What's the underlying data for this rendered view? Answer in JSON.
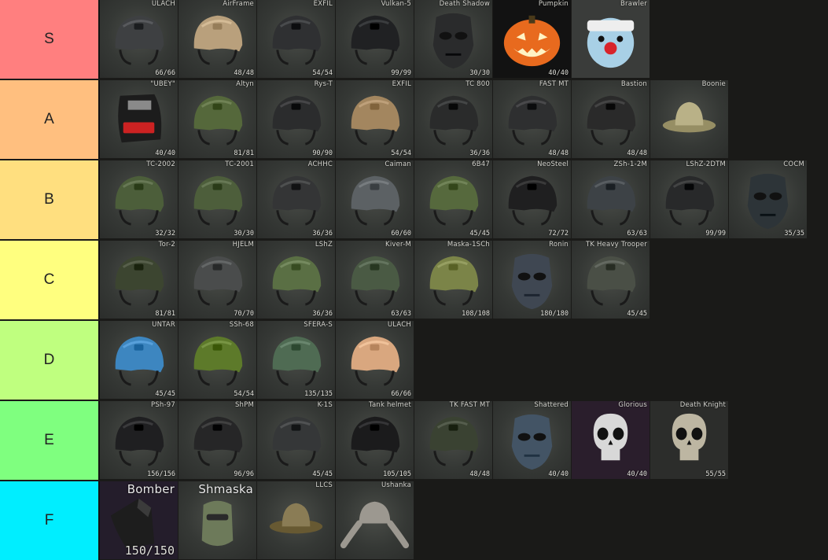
{
  "tiers": [
    {
      "label": "S",
      "color": "#ff7f7f",
      "items": [
        {
          "name": "ULACH",
          "durability": "66/66",
          "helmet": "#3e4042",
          "kind": "helmet"
        },
        {
          "name": "AirFrame",
          "durability": "48/48",
          "helmet": "#b9a07c",
          "kind": "helmet"
        },
        {
          "name": "EXFIL",
          "durability": "54/54",
          "helmet": "#2f3032",
          "kind": "helmet"
        },
        {
          "name": "Vulkan-5",
          "durability": "99/99",
          "helmet": "#202123",
          "kind": "helmet"
        },
        {
          "name": "Death Shadow",
          "durability": "30/30",
          "helmet": "#2a2b2c",
          "kind": "mask"
        },
        {
          "name": "Pumpkin",
          "durability": "40/40",
          "helmet": "#e86a1e",
          "kind": "pumpkin",
          "bg": "#121212"
        },
        {
          "name": "Brawler",
          "durability": "",
          "helmet": "#a8d0e6",
          "kind": "clown",
          "bg": "#3a3c3a"
        }
      ]
    },
    {
      "label": "A",
      "color": "#ffbf7f",
      "items": [
        {
          "name": "\"UBEY\"",
          "durability": "40/40",
          "helmet": "#1c1c1c",
          "kind": "ubey"
        },
        {
          "name": "Altyn",
          "durability": "81/81",
          "helmet": "#55683b",
          "kind": "helmet"
        },
        {
          "name": "Rys-T",
          "durability": "90/90",
          "helmet": "#2b2c2d",
          "kind": "helmet"
        },
        {
          "name": "EXFIL",
          "durability": "54/54",
          "helmet": "#a3865f",
          "kind": "helmet"
        },
        {
          "name": "TC 800",
          "durability": "36/36",
          "helmet": "#2a2b2b",
          "kind": "helmet"
        },
        {
          "name": "FAST MT",
          "durability": "48/48",
          "helmet": "#2e2f30",
          "kind": "helmet"
        },
        {
          "name": "Bastion",
          "durability": "48/48",
          "helmet": "#2a2a2a",
          "kind": "helmet"
        },
        {
          "name": "Boonie",
          "durability": "",
          "helmet": "#b9b187",
          "kind": "boonie"
        }
      ]
    },
    {
      "label": "B",
      "color": "#ffdf7f",
      "items": [
        {
          "name": "TC-2002",
          "durability": "32/32",
          "helmet": "#4c5e3a",
          "kind": "helmet"
        },
        {
          "name": "TC-2001",
          "durability": "30/30",
          "helmet": "#4d5e3b",
          "kind": "helmet"
        },
        {
          "name": "ACHHC",
          "durability": "36/36",
          "helmet": "#343536",
          "kind": "helmet"
        },
        {
          "name": "Caiman",
          "durability": "60/60",
          "helmet": "#5c6164",
          "kind": "helmet"
        },
        {
          "name": "6B47",
          "durability": "45/45",
          "helmet": "#56693d",
          "kind": "helmet"
        },
        {
          "name": "NeoSteel",
          "durability": "72/72",
          "helmet": "#1f1f20",
          "kind": "helmet"
        },
        {
          "name": "ZSh-1-2M",
          "durability": "63/63",
          "helmet": "#3d4246",
          "kind": "helmet"
        },
        {
          "name": "LShZ-2DTM",
          "durability": "99/99",
          "helmet": "#28292a",
          "kind": "helmet"
        },
        {
          "name": "COCM",
          "durability": "35/35",
          "helmet": "#2d3438",
          "kind": "mask"
        }
      ]
    },
    {
      "label": "C",
      "color": "#ffff7f",
      "items": [
        {
          "name": "Tor-2",
          "durability": "81/81",
          "helmet": "#3c4530",
          "kind": "helmet"
        },
        {
          "name": "HJELM",
          "durability": "70/70",
          "helmet": "#4a4c4c",
          "kind": "helmet"
        },
        {
          "name": "LShZ",
          "durability": "36/36",
          "helmet": "#5a6f44",
          "kind": "helmet"
        },
        {
          "name": "Kiver-M",
          "durability": "63/63",
          "helmet": "#4a5a44",
          "kind": "helmet"
        },
        {
          "name": "Maska-1SCh",
          "durability": "108/108",
          "helmet": "#7b8448",
          "kind": "helmet"
        },
        {
          "name": "Ronin",
          "durability": "180/180",
          "helmet": "#3f4752",
          "kind": "mask"
        },
        {
          "name": "TK Heavy Trooper",
          "durability": "45/45",
          "helmet": "#4a4f46",
          "kind": "helmet"
        }
      ]
    },
    {
      "label": "D",
      "color": "#bfff7f",
      "items": [
        {
          "name": "UNTAR",
          "durability": "45/45",
          "helmet": "#3d86c0",
          "kind": "helmet"
        },
        {
          "name": "SSh-68",
          "durability": "54/54",
          "helmet": "#5d7a2a",
          "kind": "helmet"
        },
        {
          "name": "SFERA-S",
          "durability": "135/135",
          "helmet": "#4f6b53",
          "kind": "helmet"
        },
        {
          "name": "ULACH",
          "durability": "66/66",
          "helmet": "#d9a77f",
          "kind": "helmet"
        }
      ]
    },
    {
      "label": "E",
      "color": "#7fff7f",
      "items": [
        {
          "name": "PSh-97",
          "durability": "156/156",
          "helmet": "#1f1f21",
          "kind": "helmet"
        },
        {
          "name": "ShPM",
          "durability": "96/96",
          "helmet": "#262627",
          "kind": "helmet"
        },
        {
          "name": "K-1S",
          "durability": "45/45",
          "helmet": "#353738",
          "kind": "helmet"
        },
        {
          "name": "Tank helmet",
          "durability": "105/105",
          "helmet": "#1b1b1c",
          "kind": "helmet"
        },
        {
          "name": "TK FAST MT",
          "durability": "48/48",
          "helmet": "#3a4232",
          "kind": "helmet"
        },
        {
          "name": "Shattered",
          "durability": "40/40",
          "helmet": "#435465",
          "kind": "mask"
        },
        {
          "name": "Glorious",
          "durability": "40/40",
          "helmet": "#d8d8d8",
          "kind": "skull",
          "bg": "#2a1e2c"
        },
        {
          "name": "Death Knight",
          "durability": "55/55",
          "helmet": "#bdb6a2",
          "kind": "skull",
          "bg": "#2c2d2b"
        }
      ]
    },
    {
      "label": "F",
      "color": "#00eeff",
      "items": [
        {
          "name": "Bomber",
          "durability": "150/150",
          "helmet": "#1d1d1d",
          "kind": "bomber",
          "bg": "#241d2b",
          "big": true
        },
        {
          "name": "Shmaska",
          "durability": "",
          "helmet": "#6d7a5a",
          "kind": "balaclava",
          "big": true
        },
        {
          "name": "LLCS",
          "durability": "",
          "helmet": "#8a7c55",
          "kind": "boonie"
        },
        {
          "name": "Ushanka",
          "durability": "",
          "helmet": "#9c9890",
          "kind": "ushanka"
        }
      ]
    }
  ]
}
